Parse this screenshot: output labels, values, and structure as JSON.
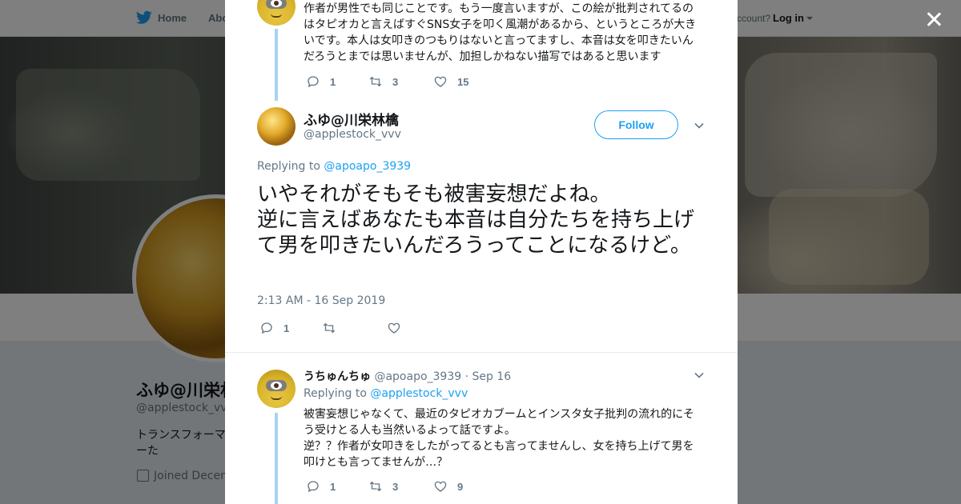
{
  "topbar": {
    "home_label": "Home",
    "about_label": "Abo",
    "account_text": "ccount?",
    "login_label": "Log in"
  },
  "profile": {
    "name": "ふゆ@川栄林檎",
    "handle": "@applestock_vvv",
    "bio": "トランスフォーマーた",
    "joined": "Joined Decem"
  },
  "thread": {
    "prev_tweet": {
      "text": "作者が男性でも同じことです。もう一度言いますが、この絵が批判されてるのはタピオカと言えばすぐSNS女子を叩く風潮があるから、というところが大きいです。本人は女叩きのつもりはないと言ってますし、本音は女を叩きたいんだろうとまでは思いませんが、加担しかねない描写ではあると思います",
      "replies": "1",
      "retweets": "3",
      "likes": "15"
    },
    "main_tweet": {
      "author_name": "ふゆ@川栄林檎",
      "author_handle": "@applestock_vvv",
      "follow_label": "Follow",
      "replying_prefix": "Replying to",
      "replying_to": "@apoapo_3939",
      "text": "いやそれがそもそも被害妄想だよね。\n逆に言えばあなたも本音は自分たちを持ち上げて男を叩きたいんだろうってことになるけど。",
      "timestamp": "2:13 AM - 16 Sep 2019",
      "replies": "1"
    },
    "reply_tweet": {
      "author_name": "うちゅんちゅ",
      "author_handle": "@apoapo_3939",
      "date": "· Sep 16",
      "replying_prefix": "Replying to",
      "replying_to": "@applestock_vvv",
      "text": "被害妄想じゃなくて、最近のタピオカブームとインスタ女子批判の流れ的にそう受けとる人も当然いるよって話ですよ。\n逆？？作者が女叩きをしたがってるとも言ってませんし、女を持ち上げて男を叩けとも言ってませんが…？",
      "replies": "1",
      "retweets": "3",
      "likes": "9"
    }
  },
  "colors": {
    "accent": "#1da1f2",
    "thread_line": "#a6d4f2",
    "muted": "#657786",
    "text": "#14171a"
  },
  "icons": [
    "twitter-bird-icon",
    "close-icon",
    "reply-icon",
    "retweet-icon",
    "like-icon",
    "chevron-down-icon",
    "calendar-icon"
  ]
}
